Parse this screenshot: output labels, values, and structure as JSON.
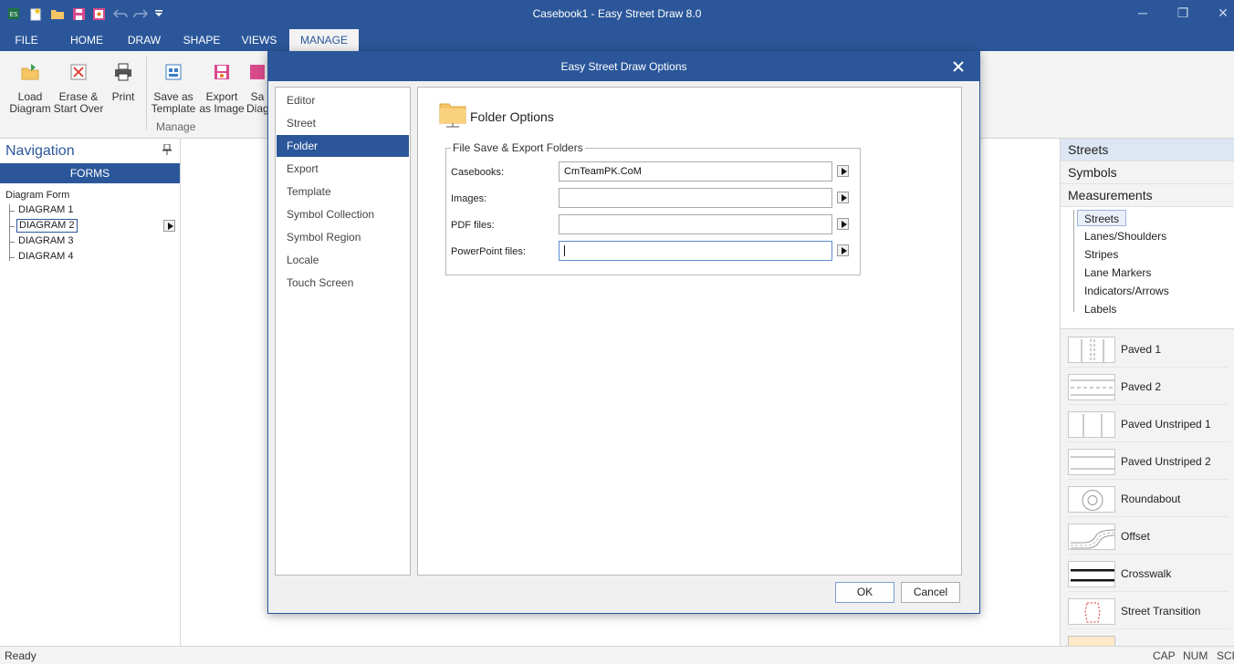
{
  "window": {
    "title": "Casebook1 - Easy Street Draw 8.0",
    "minimize_glyph": "─",
    "restore_glyph": "❐",
    "close_glyph": "✕"
  },
  "ribbon": {
    "tabs": [
      "FILE",
      "HOME",
      "DRAW",
      "SHAPE",
      "VIEWS",
      "MANAGE"
    ],
    "active_tab": "MANAGE",
    "buttons": [
      {
        "line1": "Load",
        "line2": "Diagram",
        "icon": "load-diagram-icon"
      },
      {
        "line1": "Erase &",
        "line2": "Start Over",
        "icon": "erase-icon"
      },
      {
        "line1": "Print",
        "line2": "",
        "icon": "printer-icon"
      },
      {
        "line1": "Save as",
        "line2": "Template",
        "icon": "save-template-icon"
      },
      {
        "line1": "Export",
        "line2": "as Image",
        "icon": "export-image-icon"
      },
      {
        "line1": "Sa",
        "line2": "Diag",
        "icon": "save-diagram-icon"
      }
    ],
    "group_label": "Manage"
  },
  "navigation": {
    "title": "Navigation",
    "forms_label": "FORMS",
    "root": "Diagram Form",
    "items": [
      "DIAGRAM 1",
      "DIAGRAM 2",
      "DIAGRAM 3",
      "DIAGRAM 4"
    ],
    "selected": "DIAGRAM 2"
  },
  "right_pane": {
    "categories": [
      "Streets",
      "Symbols",
      "Measurements"
    ],
    "active_category": "Streets",
    "subitems": [
      "Streets",
      "Lanes/Shoulders",
      "Stripes",
      "Lane Markers",
      "Indicators/Arrows",
      "Labels"
    ],
    "selected_subitem": "Streets",
    "shapes": [
      "Paved 1",
      "Paved 2",
      "Paved Unstriped 1",
      "Paved Unstriped 2",
      "Roundabout",
      "Offset",
      "Crosswalk",
      "Street Transition"
    ]
  },
  "dialog": {
    "title": "Easy Street Draw Options",
    "categories": [
      "Editor",
      "Street",
      "Folder",
      "Export",
      "Template",
      "Symbol Collection",
      "Symbol Region",
      "Locale",
      "Touch Screen"
    ],
    "active_category": "Folder",
    "panel_title": "Folder Options",
    "group_title": "File Save & Export Folders",
    "fields": [
      {
        "label": "Casebooks:",
        "value": "CmTeamPK.CoM"
      },
      {
        "label": "Images:",
        "value": ""
      },
      {
        "label": "PDF files:",
        "value": ""
      },
      {
        "label": "PowerPoint files:",
        "value": ""
      }
    ],
    "ok_label": "OK",
    "cancel_label": "Cancel"
  },
  "status": {
    "text": "Ready",
    "indicators": [
      "CAP",
      "NUM",
      "SCR"
    ]
  },
  "colors": {
    "accent": "#2b579a",
    "ribbon_bg": "#f3f3f3"
  }
}
